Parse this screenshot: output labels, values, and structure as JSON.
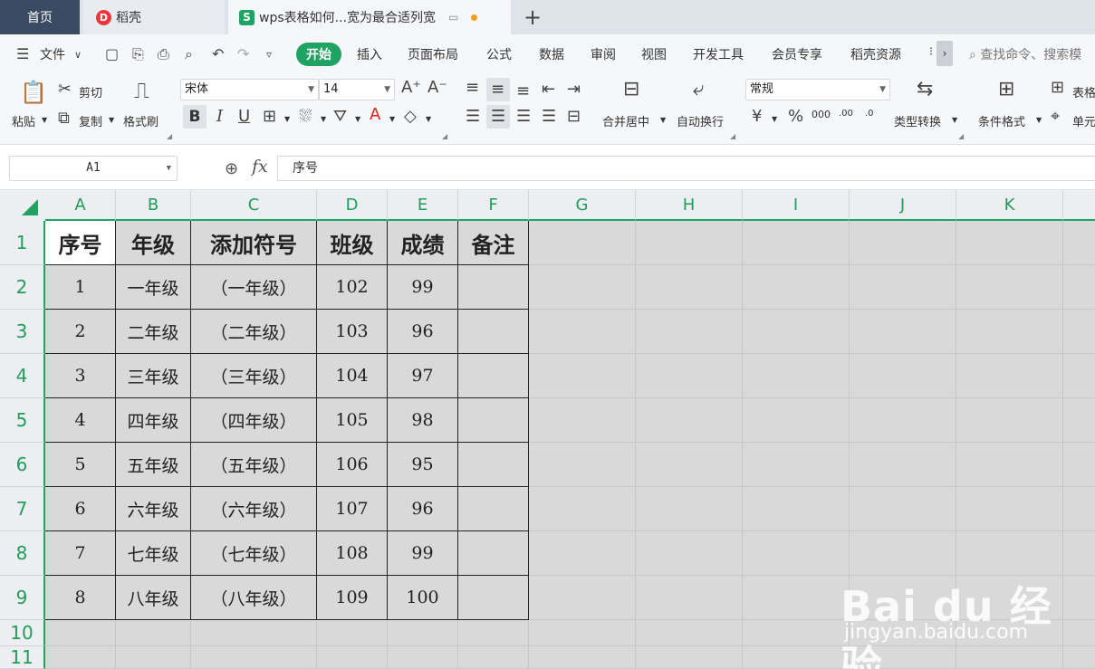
{
  "tabs": {
    "home": "首页",
    "daoke": "稻壳",
    "active": "wps表格如何...宽为最合适列宽",
    "new_tab": "+"
  },
  "menubar": {
    "file": "文件",
    "items": [
      "开始",
      "插入",
      "页面布局",
      "公式",
      "数据",
      "审阅",
      "视图",
      "开发工具",
      "会员专享",
      "稻壳资源"
    ],
    "search_placeholder": "查找命令、搜索模"
  },
  "toolbar": {
    "paste": "粘贴",
    "cut": "剪切",
    "copy": "复制",
    "format_painter": "格式刷",
    "font_name": "宋体",
    "font_size": "14",
    "bold": "B",
    "italic": "I",
    "underline": "U",
    "merge_center": "合并居中",
    "wrap_text": "自动换行",
    "number_format": "常规",
    "type_convert": "类型转换",
    "conditional_format": "条件格式",
    "table_style": "表格",
    "cell": "单元"
  },
  "formula_bar": {
    "name_box": "A1",
    "fx": "fx",
    "content": "序号"
  },
  "sheet": {
    "columns": [
      "A",
      "B",
      "C",
      "D",
      "E",
      "F",
      "G",
      "H",
      "I",
      "J",
      "K"
    ],
    "rows": [
      "1",
      "2",
      "3",
      "4",
      "5",
      "6",
      "7",
      "8",
      "9",
      "10",
      "11"
    ],
    "headers": [
      "序号",
      "年级",
      "添加符号",
      "班级",
      "成绩",
      "备注"
    ],
    "data": [
      [
        "1",
        "一年级",
        "（一年级）",
        "102",
        "99",
        ""
      ],
      [
        "2",
        "二年级",
        "（二年级）",
        "103",
        "96",
        ""
      ],
      [
        "3",
        "三年级",
        "（三年级）",
        "104",
        "97",
        ""
      ],
      [
        "4",
        "四年级",
        "（四年级）",
        "105",
        "98",
        ""
      ],
      [
        "5",
        "五年级",
        "（五年级）",
        "106",
        "95",
        ""
      ],
      [
        "6",
        "六年级",
        "（六年级）",
        "107",
        "96",
        ""
      ],
      [
        "7",
        "七年级",
        "（七年级）",
        "108",
        "99",
        ""
      ],
      [
        "8",
        "八年级",
        "（八年级）",
        "109",
        "100",
        ""
      ]
    ]
  },
  "watermark": {
    "brand": "Bai du 经验",
    "url": "jingyan.baidu.com"
  },
  "colors": {
    "accent": "#1ea362",
    "tab_home": "#3b4a63",
    "sheet_bg": "#d9d9d9"
  }
}
